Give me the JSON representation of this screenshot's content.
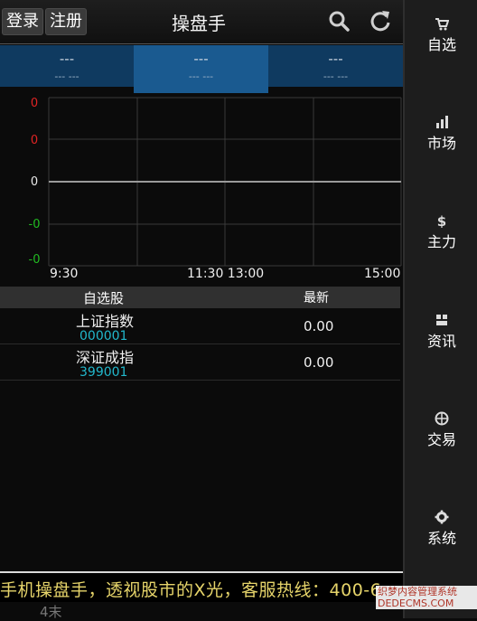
{
  "header": {
    "login_label": "登录",
    "register_label": "注册",
    "title": "操盘手"
  },
  "indices": [
    {
      "name": "---",
      "change": "--- ---"
    },
    {
      "name": "---",
      "change": "--- ---"
    },
    {
      "name": "---",
      "change": "--- ---"
    }
  ],
  "chart": {
    "y_labels": [
      "0",
      "0",
      "0",
      "-0",
      "-0"
    ],
    "x_labels": [
      "9:30",
      "11:30 13:00",
      "15:00"
    ],
    "colors": {
      "up": "#e02424",
      "flat": "#e8e8e8",
      "down": "#22bb22"
    }
  },
  "chart_data": {
    "type": "line",
    "x": [
      "9:30",
      "11:30 13:00",
      "15:00"
    ],
    "series": [],
    "ylabel": "",
    "xlabel": "",
    "grid": true
  },
  "watchlist": {
    "header_name": "自选股",
    "header_latest": "最新",
    "rows": [
      {
        "name": "上证指数",
        "code": "000001",
        "latest": "0.00"
      },
      {
        "name": "深证成指",
        "code": "399001",
        "latest": "0.00"
      }
    ]
  },
  "sidebar": {
    "items": [
      {
        "label": "自选",
        "icon": "cart-icon"
      },
      {
        "label": "市场",
        "icon": "bar-chart-icon"
      },
      {
        "label": "主力",
        "icon": "dollar-icon"
      },
      {
        "label": "资讯",
        "icon": "grid-icon"
      },
      {
        "label": "交易",
        "icon": "globe-icon"
      },
      {
        "label": "系统",
        "icon": "gear-icon"
      }
    ]
  },
  "ticker": {
    "text": "手机操盘手，透视股市的X光，客服热线：400-6"
  },
  "watermark": {
    "line1": "织梦内容管理系统",
    "line2": "DEDECMS.COM"
  },
  "bottom": {
    "text": "4末"
  }
}
